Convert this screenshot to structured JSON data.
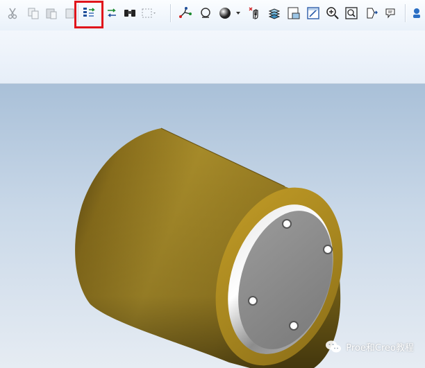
{
  "toolbar": {
    "buttons": [
      {
        "icon": "cut-icon",
        "enabled": false
      },
      {
        "icon": "copy-icon",
        "enabled": false
      },
      {
        "icon": "paste-icon",
        "enabled": false
      },
      {
        "icon": "paste-special-icon",
        "enabled": false
      },
      {
        "icon": "regenerate-icon",
        "enabled": true,
        "highlighted": true
      },
      {
        "icon": "regeneration-manager-icon",
        "enabled": true
      },
      {
        "icon": "find-icon",
        "enabled": true
      },
      {
        "icon": "select-box-icon",
        "enabled": false
      },
      {
        "icon": "datum-display-icon",
        "enabled": true
      },
      {
        "icon": "repaint-icon",
        "enabled": true
      },
      {
        "icon": "shading-icon",
        "enabled": true
      },
      {
        "icon": "spin-center-icon",
        "enabled": true
      },
      {
        "icon": "layers-icon",
        "enabled": true
      },
      {
        "icon": "saved-view-icon",
        "enabled": true
      },
      {
        "icon": "orient-icon",
        "enabled": true
      },
      {
        "icon": "zoom-in-icon",
        "enabled": true
      },
      {
        "icon": "refit-icon",
        "enabled": true
      },
      {
        "icon": "perspective-icon",
        "enabled": true
      },
      {
        "icon": "annotation-icon",
        "enabled": true
      },
      {
        "icon": "model-tree-icon",
        "enabled": true
      }
    ],
    "highlight_color": "#e0141b"
  },
  "viewport": {
    "background_top": "#a9c0d8",
    "background_bottom": "#e6ecf3",
    "model": {
      "body_color": "#a08524",
      "face_color": "#8a8a8a",
      "hole_count": 4
    }
  },
  "watermark": {
    "icon": "wechat-icon",
    "text": "Proe和Creo教程"
  }
}
